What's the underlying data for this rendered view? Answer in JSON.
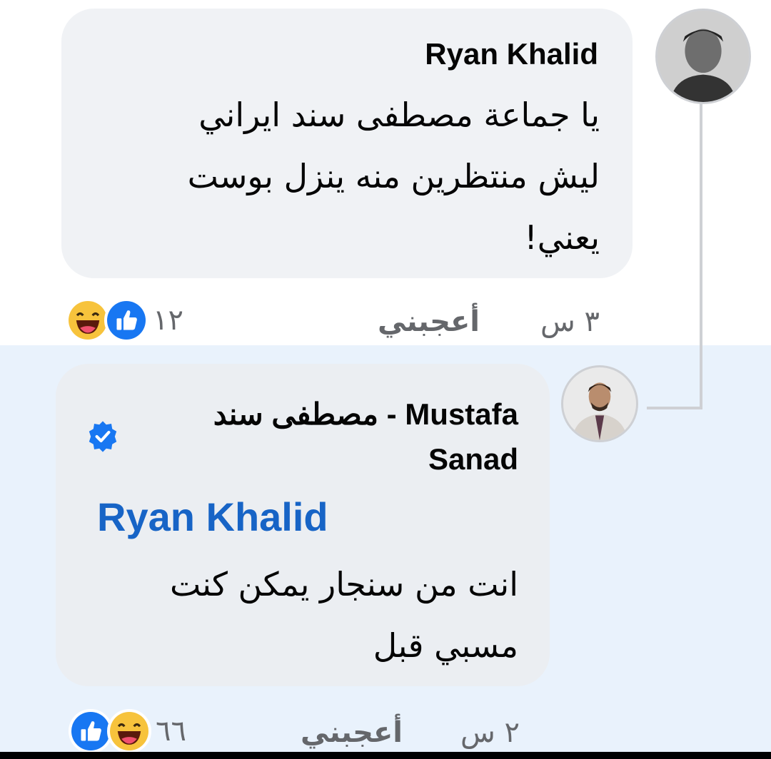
{
  "colors": {
    "accent": "#1764c6",
    "highlight": "#e9f2fc",
    "bubble": "#f0f2f5",
    "meta": "#65676b"
  },
  "comment": {
    "author": "Ryan Khalid",
    "lines": [
      "يا جماعة مصطفى سند ايراني",
      "ليش منتظرين منه ينزل بوست",
      "يعني!"
    ],
    "time": "٣ س",
    "like_label": "أعجبني",
    "reaction_icons": [
      "haha-reaction-icon",
      "like-reaction-icon"
    ],
    "reaction_count": "١٢"
  },
  "reply": {
    "author_line1": "مصطفى سند - Mustafa",
    "author_line2": "Sanad",
    "verified_icon": "verified-badge-icon",
    "mention": "Ryan Khalid",
    "lines": [
      "انت من سنجار يمكن كنت",
      "مسبي قبل"
    ],
    "time": "٢ س",
    "like_label": "أعجبني",
    "reaction_icons": [
      "like-reaction-icon",
      "haha-reaction-icon"
    ],
    "reaction_count": "٦٦"
  }
}
